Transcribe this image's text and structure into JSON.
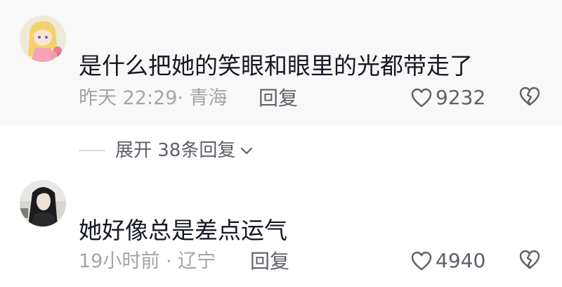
{
  "comments": [
    {
      "text": "是什么把她的笑眼和眼里的光都带走了",
      "meta": "昨天 22:29· 青海",
      "reply_label": "回复",
      "like_count": "9232"
    },
    {
      "text": "她好像总是差点运气",
      "meta": "19小时前 · 辽宁",
      "reply_label": "回复",
      "like_count": "4940"
    }
  ],
  "expand": {
    "label": "展开 38条回复"
  },
  "icons": {
    "like": "heart-icon",
    "dislike": "broken-heart-icon",
    "expand": "chevron-down-icon"
  },
  "colors": {
    "primary_text": "#161823",
    "secondary_text": "#a4a5ab",
    "action_text": "#5f6068",
    "highlight_bg": "#f8f8f8"
  }
}
